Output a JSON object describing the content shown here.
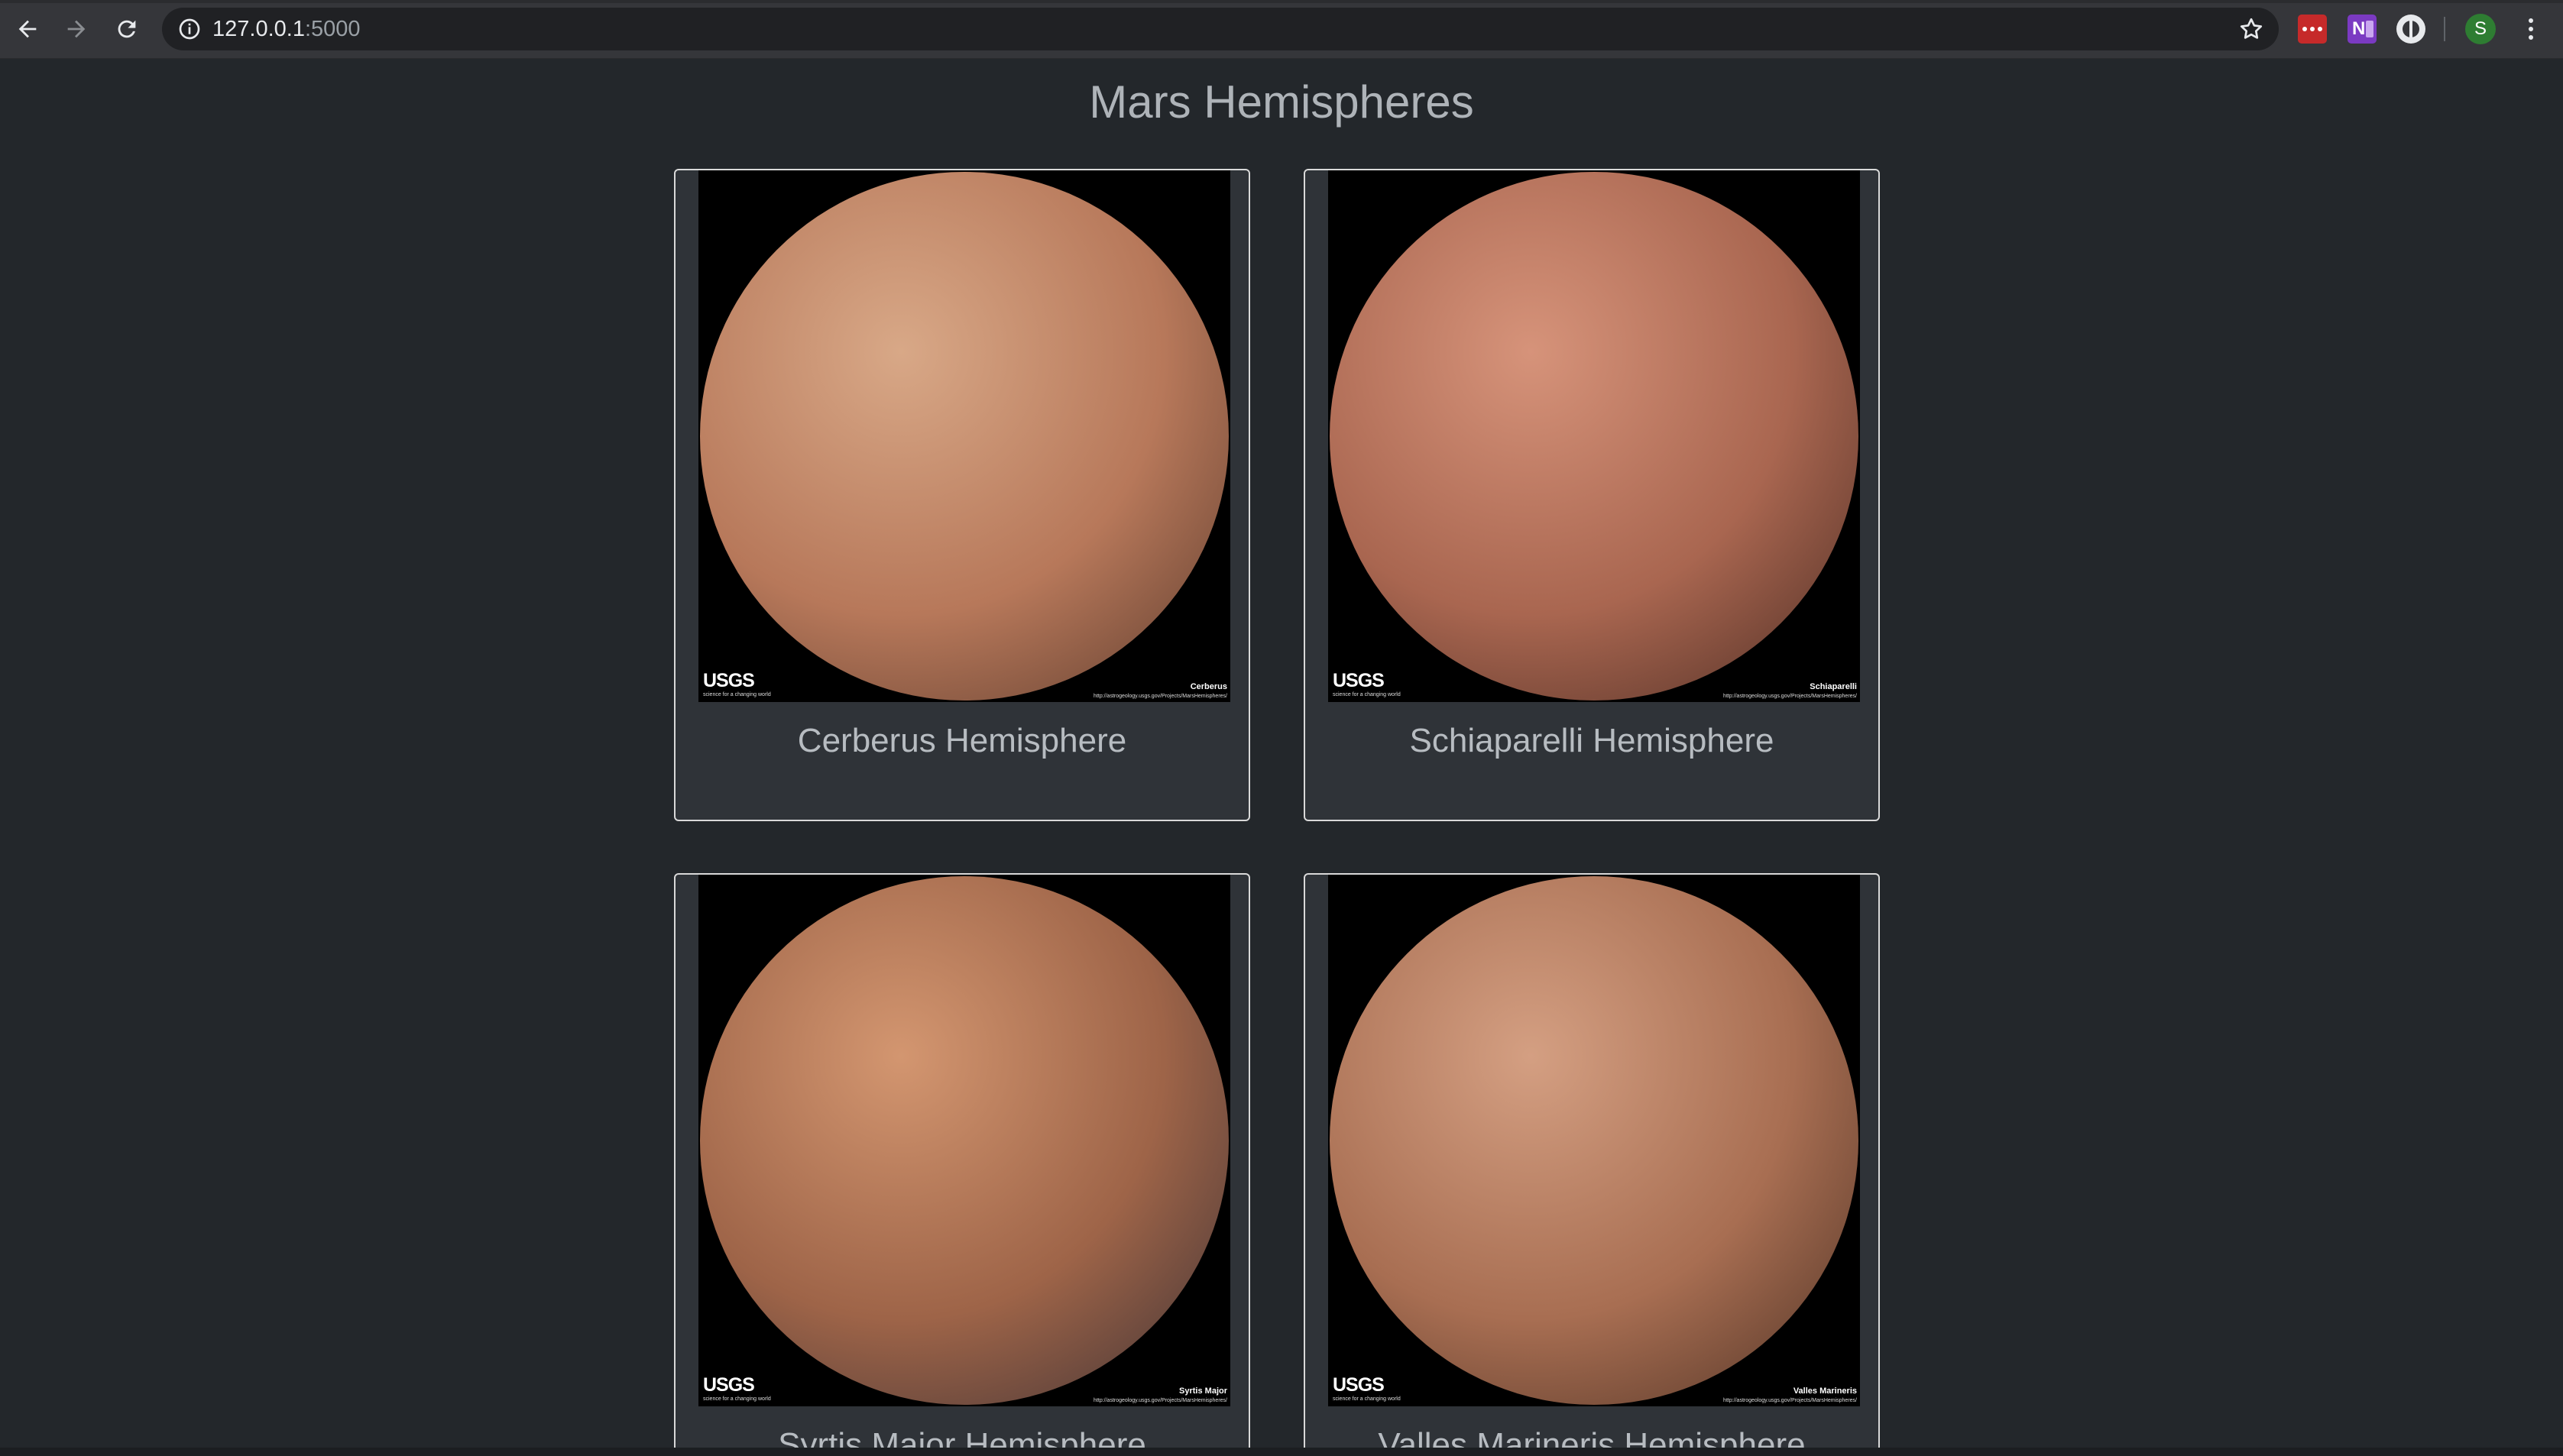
{
  "browser": {
    "url_host": "127.0.0.1",
    "url_port": ":5000",
    "avatar_initial": "S"
  },
  "page": {
    "title": "Mars Hemispheres"
  },
  "hemispheres": [
    {
      "title": "Cerberus Hemisphere",
      "photo_label": "Cerberus",
      "photo_brand": "USGS",
      "photo_tagline": "science for a changing world",
      "photo_url": "http://astrogeology.usgs.gov/Projects/MarsHemispheres/",
      "colors": [
        "#d8a887",
        "#b7785a",
        "#5b3a2c"
      ]
    },
    {
      "title": "Schiaparelli Hemisphere",
      "photo_label": "Schiaparelli",
      "photo_brand": "USGS",
      "photo_tagline": "science for a changing world",
      "photo_url": "http://astrogeology.usgs.gov/Projects/MarsHemispheres/",
      "colors": [
        "#d6937a",
        "#a96650",
        "#4a2b22"
      ]
    },
    {
      "title": "Syrtis Major Hemisphere",
      "photo_label": "Syrtis Major",
      "photo_brand": "USGS",
      "photo_tagline": "science for a changing world",
      "photo_url": "http://astrogeology.usgs.gov/Projects/MarsHemispheres/",
      "colors": [
        "#d39670",
        "#9e6448",
        "#3b3034"
      ]
    },
    {
      "title": "Valles Marineris Hemisphere",
      "photo_label": "Valles Marineris",
      "photo_brand": "USGS",
      "photo_tagline": "science for a changing world",
      "photo_url": "http://astrogeology.usgs.gov/Projects/MarsHemispheres/",
      "colors": [
        "#d49f82",
        "#a86e52",
        "#4c3023"
      ]
    }
  ]
}
